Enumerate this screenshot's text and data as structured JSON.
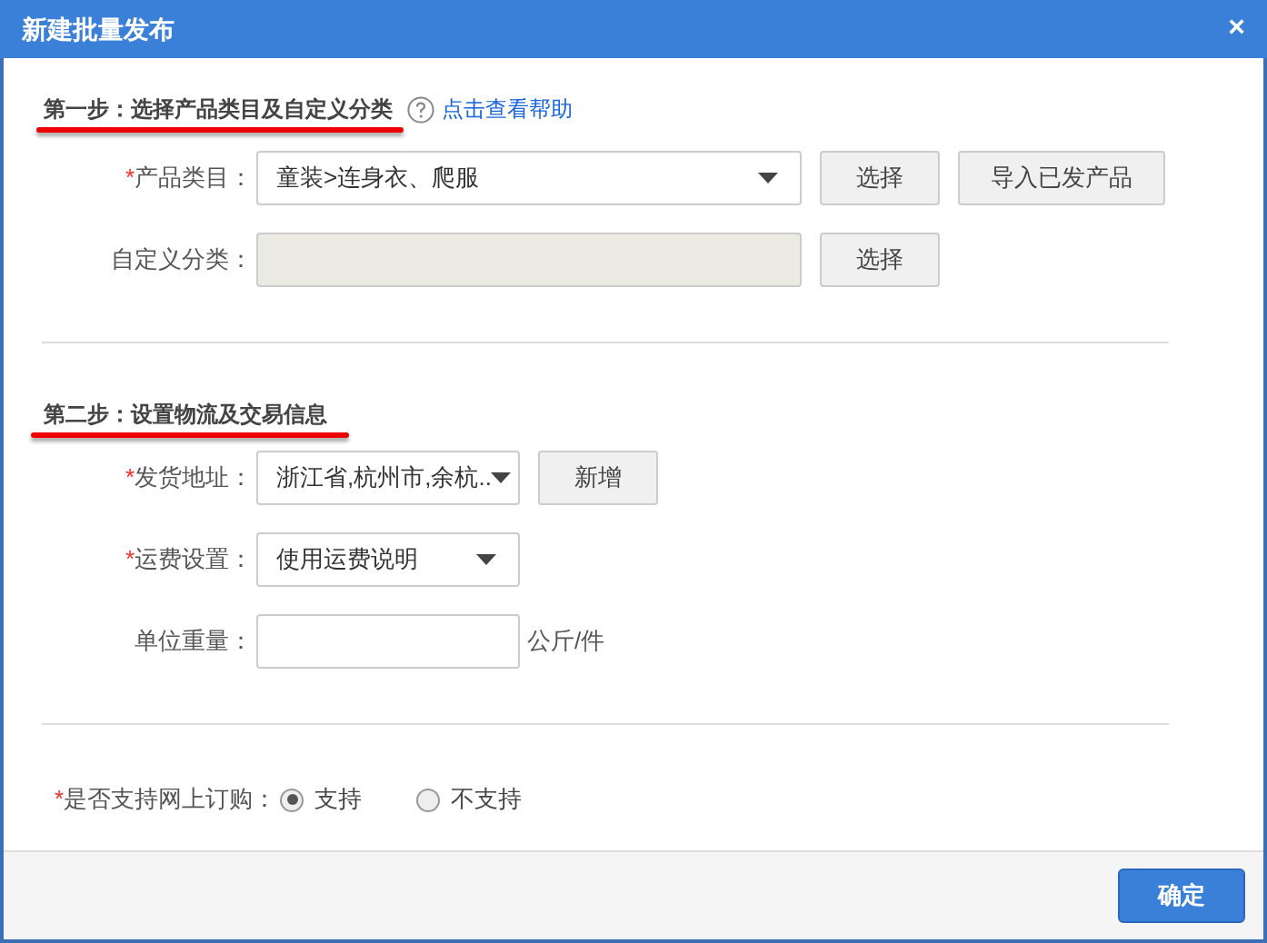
{
  "window": {
    "title": "新建批量发布",
    "close": "×"
  },
  "required_mark": "*",
  "step1": {
    "heading": "第一步：选择产品类目及自定义分类",
    "help_link": "点击查看帮助",
    "fields": [
      {
        "kind": "select",
        "label": "产品类目：",
        "required": true,
        "value": "童装>连身衣、爬服",
        "buttons": [
          "选择",
          "导入已发产品"
        ]
      },
      {
        "kind": "disabled_input",
        "label": "自定义分类：",
        "required": false,
        "buttons": [
          "选择"
        ]
      }
    ]
  },
  "step2": {
    "heading": "第二步：设置物流及交易信息",
    "fields": [
      {
        "kind": "select",
        "label": "发货地址：",
        "required": true,
        "value": "浙江省,杭州市,余杭..",
        "buttons": [
          "新增"
        ]
      },
      {
        "kind": "select",
        "label": "运费设置：",
        "required": true,
        "value": "使用运费说明"
      },
      {
        "kind": "input",
        "label": "单位重量：",
        "required": false,
        "unit": "公斤/件"
      }
    ]
  },
  "order_online": {
    "label": "是否支持网上订购：",
    "required": true,
    "options": [
      {
        "label": "支持",
        "selected": true
      },
      {
        "label": "不支持",
        "selected": false
      }
    ]
  },
  "footer": {
    "confirm": "确定"
  }
}
